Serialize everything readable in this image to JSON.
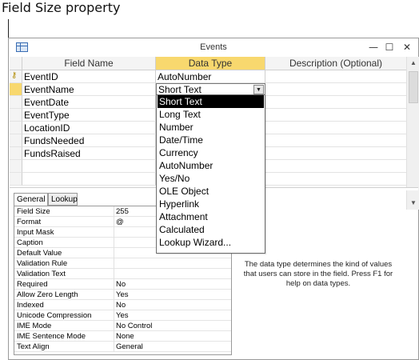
{
  "callout": {
    "text": "Field Size property"
  },
  "window": {
    "title": "Events",
    "minimize_label": "—",
    "maximize_label": "☐",
    "close_label": "✕"
  },
  "grid": {
    "headers": {
      "field_name": "Field Name",
      "data_type": "Data Type",
      "description": "Description (Optional)"
    },
    "rows": [
      {
        "field_name": "EventID",
        "data_type": "AutoNumber",
        "primary_key": true
      },
      {
        "field_name": "EventName",
        "data_type": "Short Text",
        "active": true
      },
      {
        "field_name": "EventDate",
        "data_type": ""
      },
      {
        "field_name": "EventType",
        "data_type": ""
      },
      {
        "field_name": "LocationID",
        "data_type": ""
      },
      {
        "field_name": "FundsNeeded",
        "data_type": ""
      },
      {
        "field_name": "FundsRaised",
        "data_type": ""
      }
    ]
  },
  "dropdown": {
    "selected": "Short Text",
    "options": [
      "Short Text",
      "Long Text",
      "Number",
      "Date/Time",
      "Currency",
      "AutoNumber",
      "Yes/No",
      "OLE Object",
      "Hyperlink",
      "Attachment",
      "Calculated",
      "Lookup Wizard..."
    ]
  },
  "tabs": {
    "general": "General",
    "lookup": "Lookup"
  },
  "properties": [
    {
      "label": "Field Size",
      "value": "255"
    },
    {
      "label": "Format",
      "value": "@"
    },
    {
      "label": "Input Mask",
      "value": ""
    },
    {
      "label": "Caption",
      "value": ""
    },
    {
      "label": "Default Value",
      "value": ""
    },
    {
      "label": "Validation Rule",
      "value": ""
    },
    {
      "label": "Validation Text",
      "value": ""
    },
    {
      "label": "Required",
      "value": "No"
    },
    {
      "label": "Allow Zero Length",
      "value": "Yes"
    },
    {
      "label": "Indexed",
      "value": "No"
    },
    {
      "label": "Unicode Compression",
      "value": "Yes"
    },
    {
      "label": "IME Mode",
      "value": "No Control"
    },
    {
      "label": "IME Sentence Mode",
      "value": "None"
    },
    {
      "label": "Text Align",
      "value": "General"
    }
  ],
  "help": {
    "text": "The data type determines the kind of values that users can store in the field. Press F1 for help on data types."
  },
  "icons": {
    "table": "table-icon",
    "key": "primary-key-icon",
    "dropdown": "chevron-down-icon"
  },
  "colors": {
    "header_selected": "#f8d86e",
    "highlight": "#000000"
  }
}
